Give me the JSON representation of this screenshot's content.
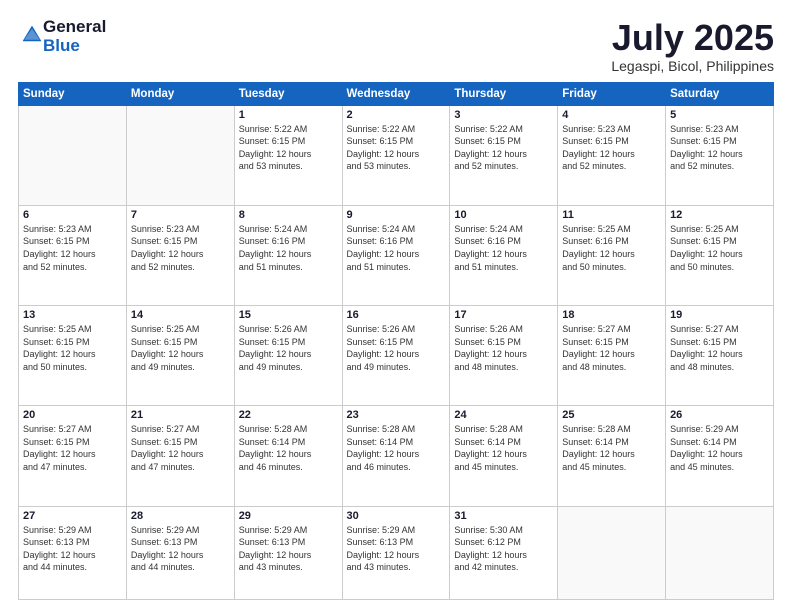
{
  "logo": {
    "general": "General",
    "blue": "Blue"
  },
  "title": "July 2025",
  "location": "Legaspi, Bicol, Philippines",
  "weekdays": [
    "Sunday",
    "Monday",
    "Tuesday",
    "Wednesday",
    "Thursday",
    "Friday",
    "Saturday"
  ],
  "weeks": [
    [
      {
        "day": "",
        "info": ""
      },
      {
        "day": "",
        "info": ""
      },
      {
        "day": "1",
        "info": "Sunrise: 5:22 AM\nSunset: 6:15 PM\nDaylight: 12 hours\nand 53 minutes."
      },
      {
        "day": "2",
        "info": "Sunrise: 5:22 AM\nSunset: 6:15 PM\nDaylight: 12 hours\nand 53 minutes."
      },
      {
        "day": "3",
        "info": "Sunrise: 5:22 AM\nSunset: 6:15 PM\nDaylight: 12 hours\nand 52 minutes."
      },
      {
        "day": "4",
        "info": "Sunrise: 5:23 AM\nSunset: 6:15 PM\nDaylight: 12 hours\nand 52 minutes."
      },
      {
        "day": "5",
        "info": "Sunrise: 5:23 AM\nSunset: 6:15 PM\nDaylight: 12 hours\nand 52 minutes."
      }
    ],
    [
      {
        "day": "6",
        "info": "Sunrise: 5:23 AM\nSunset: 6:15 PM\nDaylight: 12 hours\nand 52 minutes."
      },
      {
        "day": "7",
        "info": "Sunrise: 5:23 AM\nSunset: 6:15 PM\nDaylight: 12 hours\nand 52 minutes."
      },
      {
        "day": "8",
        "info": "Sunrise: 5:24 AM\nSunset: 6:16 PM\nDaylight: 12 hours\nand 51 minutes."
      },
      {
        "day": "9",
        "info": "Sunrise: 5:24 AM\nSunset: 6:16 PM\nDaylight: 12 hours\nand 51 minutes."
      },
      {
        "day": "10",
        "info": "Sunrise: 5:24 AM\nSunset: 6:16 PM\nDaylight: 12 hours\nand 51 minutes."
      },
      {
        "day": "11",
        "info": "Sunrise: 5:25 AM\nSunset: 6:16 PM\nDaylight: 12 hours\nand 50 minutes."
      },
      {
        "day": "12",
        "info": "Sunrise: 5:25 AM\nSunset: 6:15 PM\nDaylight: 12 hours\nand 50 minutes."
      }
    ],
    [
      {
        "day": "13",
        "info": "Sunrise: 5:25 AM\nSunset: 6:15 PM\nDaylight: 12 hours\nand 50 minutes."
      },
      {
        "day": "14",
        "info": "Sunrise: 5:25 AM\nSunset: 6:15 PM\nDaylight: 12 hours\nand 49 minutes."
      },
      {
        "day": "15",
        "info": "Sunrise: 5:26 AM\nSunset: 6:15 PM\nDaylight: 12 hours\nand 49 minutes."
      },
      {
        "day": "16",
        "info": "Sunrise: 5:26 AM\nSunset: 6:15 PM\nDaylight: 12 hours\nand 49 minutes."
      },
      {
        "day": "17",
        "info": "Sunrise: 5:26 AM\nSunset: 6:15 PM\nDaylight: 12 hours\nand 48 minutes."
      },
      {
        "day": "18",
        "info": "Sunrise: 5:27 AM\nSunset: 6:15 PM\nDaylight: 12 hours\nand 48 minutes."
      },
      {
        "day": "19",
        "info": "Sunrise: 5:27 AM\nSunset: 6:15 PM\nDaylight: 12 hours\nand 48 minutes."
      }
    ],
    [
      {
        "day": "20",
        "info": "Sunrise: 5:27 AM\nSunset: 6:15 PM\nDaylight: 12 hours\nand 47 minutes."
      },
      {
        "day": "21",
        "info": "Sunrise: 5:27 AM\nSunset: 6:15 PM\nDaylight: 12 hours\nand 47 minutes."
      },
      {
        "day": "22",
        "info": "Sunrise: 5:28 AM\nSunset: 6:14 PM\nDaylight: 12 hours\nand 46 minutes."
      },
      {
        "day": "23",
        "info": "Sunrise: 5:28 AM\nSunset: 6:14 PM\nDaylight: 12 hours\nand 46 minutes."
      },
      {
        "day": "24",
        "info": "Sunrise: 5:28 AM\nSunset: 6:14 PM\nDaylight: 12 hours\nand 45 minutes."
      },
      {
        "day": "25",
        "info": "Sunrise: 5:28 AM\nSunset: 6:14 PM\nDaylight: 12 hours\nand 45 minutes."
      },
      {
        "day": "26",
        "info": "Sunrise: 5:29 AM\nSunset: 6:14 PM\nDaylight: 12 hours\nand 45 minutes."
      }
    ],
    [
      {
        "day": "27",
        "info": "Sunrise: 5:29 AM\nSunset: 6:13 PM\nDaylight: 12 hours\nand 44 minutes."
      },
      {
        "day": "28",
        "info": "Sunrise: 5:29 AM\nSunset: 6:13 PM\nDaylight: 12 hours\nand 44 minutes."
      },
      {
        "day": "29",
        "info": "Sunrise: 5:29 AM\nSunset: 6:13 PM\nDaylight: 12 hours\nand 43 minutes."
      },
      {
        "day": "30",
        "info": "Sunrise: 5:29 AM\nSunset: 6:13 PM\nDaylight: 12 hours\nand 43 minutes."
      },
      {
        "day": "31",
        "info": "Sunrise: 5:30 AM\nSunset: 6:12 PM\nDaylight: 12 hours\nand 42 minutes."
      },
      {
        "day": "",
        "info": ""
      },
      {
        "day": "",
        "info": ""
      }
    ]
  ]
}
